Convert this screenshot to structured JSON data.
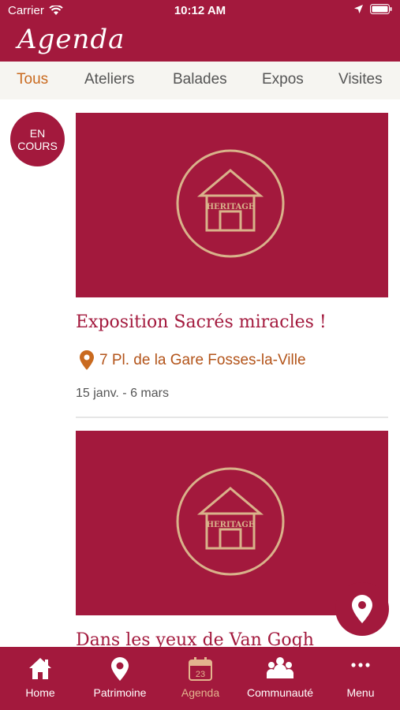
{
  "status": {
    "carrier": "Carrier",
    "time": "10:12 AM"
  },
  "header": {
    "title": "Agenda"
  },
  "tabs": [
    {
      "label": "Tous",
      "active": true
    },
    {
      "label": "Ateliers"
    },
    {
      "label": "Balades"
    },
    {
      "label": "Expos"
    },
    {
      "label": "Visites"
    }
  ],
  "badge": {
    "line1": "EN",
    "line2": "COURS"
  },
  "cards": [
    {
      "image_label": "HERITAGE",
      "title": "Exposition Sacrés miracles !",
      "location": "7 Pl. de la Gare Fosses-la-Ville",
      "date": "15 janv. - 6 mars"
    },
    {
      "image_label": "HERITAGE",
      "title": "Dans les yeux de Van Gogh"
    }
  ],
  "bottom_nav": [
    {
      "label": "Home",
      "icon": "home-icon"
    },
    {
      "label": "Patrimoine",
      "icon": "map-pin-icon"
    },
    {
      "label": "Agenda",
      "icon": "calendar-icon",
      "calendar_day": "23",
      "active": true
    },
    {
      "label": "Communauté",
      "icon": "community-icon"
    },
    {
      "label": "Menu",
      "icon": "more-icon"
    }
  ],
  "colors": {
    "brand": "#a3193d",
    "accent": "#c96a1f",
    "active_nav": "#e3b48e"
  }
}
